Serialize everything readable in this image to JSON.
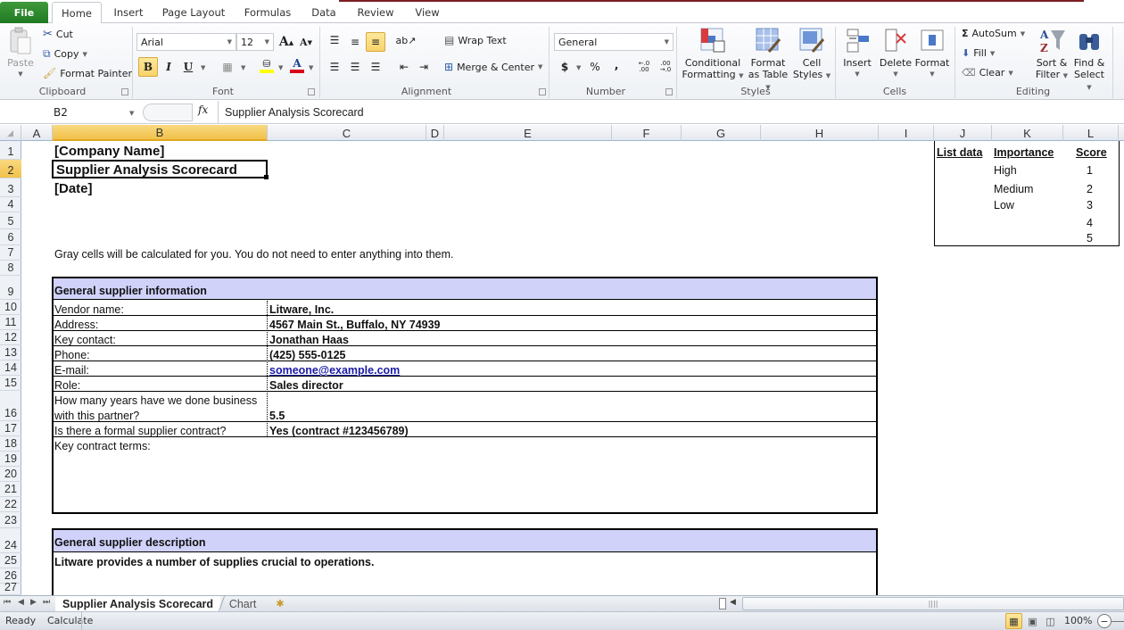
{
  "ribbon_tabs": {
    "file": "File",
    "items": [
      "Home",
      "Insert",
      "Page Layout",
      "Formulas",
      "Data",
      "Review",
      "View"
    ],
    "active": "Home"
  },
  "clipboard": {
    "paste": "Paste",
    "cut": "Cut",
    "copy": "Copy",
    "format_painter": "Format Painter",
    "label": "Clipboard"
  },
  "font": {
    "name": "Arial",
    "size": "12",
    "bold": "B",
    "italic": "I",
    "underline": "U",
    "label": "Font",
    "grow": "A",
    "shrink": "A",
    "font_color": "A"
  },
  "alignment": {
    "wrap_text": "Wrap Text",
    "merge_center": "Merge & Center",
    "label": "Alignment"
  },
  "number": {
    "format": "General",
    "currency": "$",
    "percent": "%",
    "comma": ",",
    "inc_decimal": "←.0 .00",
    "dec_decimal": ".00 →.0",
    "label": "Number"
  },
  "styles": {
    "conditional_1": "Conditional",
    "conditional_2": "Formatting",
    "format_table_1": "Format",
    "format_table_2": "as Table",
    "cell_styles_1": "Cell",
    "cell_styles_2": "Styles",
    "label": "Styles"
  },
  "cells": {
    "insert": "Insert",
    "delete": "Delete",
    "format": "Format",
    "label": "Cells"
  },
  "editing": {
    "autosum": "AutoSum",
    "fill": "Fill",
    "clear": "Clear",
    "sort_1": "Sort &",
    "sort_2": "Filter",
    "find_1": "Find &",
    "find_2": "Select",
    "label": "Editing"
  },
  "formula_bar": {
    "name_box": "B2",
    "fx": "fx",
    "content": "Supplier Analysis Scorecard"
  },
  "columns": [
    "A",
    "B",
    "C",
    "D",
    "E",
    "F",
    "G",
    "H",
    "I",
    "J",
    "K",
    "L"
  ],
  "selected_column": "B",
  "rows": [
    "1",
    "2",
    "3",
    "4",
    "5",
    "6",
    "7",
    "8",
    "9",
    "10",
    "11",
    "12",
    "13",
    "14",
    "15",
    "16",
    "17",
    "18",
    "19",
    "20",
    "21",
    "22",
    "23",
    "24",
    "25",
    "26",
    "27"
  ],
  "selected_row": "2",
  "sheet": {
    "company_name": "[Company Name]",
    "title": "Supplier Analysis Scorecard",
    "date": "[Date]",
    "note": "Gray cells will be calculated for you. You do not need to enter anything into them.",
    "section1_header": "General supplier information",
    "fields": [
      {
        "label": "Vendor name:",
        "value": "Litware, Inc."
      },
      {
        "label": "Address:",
        "value": "4567 Main St., Buffalo, NY 74939"
      },
      {
        "label": "Key contact:",
        "value": "Jonathan Haas"
      },
      {
        "label": "Phone:",
        "value": "(425) 555-0125"
      },
      {
        "label": "E-mail:",
        "value": "someone@example.com"
      },
      {
        "label": "Role:",
        "value": "Sales director"
      }
    ],
    "years_label_1": "How many years have we done business",
    "years_label_2": "with this partner?",
    "years_value": "5.5",
    "contract_label": "Is there a formal supplier contract?",
    "contract_value": "Yes (contract #123456789)",
    "key_terms_label": "Key contract terms:",
    "section2_header": "General supplier description",
    "description": "Litware provides a number of supplies crucial to operations."
  },
  "list_data": {
    "title": "List data",
    "importance_header": "Importance",
    "score_header": "Score",
    "importance": [
      "High",
      "Medium",
      "Low"
    ],
    "scores": [
      "1",
      "2",
      "3",
      "4",
      "5"
    ]
  },
  "sheet_tabs": [
    "Supplier Analysis Scorecard",
    "Chart"
  ],
  "active_sheet": "Supplier Analysis Scorecard",
  "status": {
    "ready": "Ready",
    "calculate": "Calculate",
    "zoom": "100%"
  },
  "colors": {
    "accent_file": "#2b8a2f",
    "table_header": "#d0d2fa",
    "selection": "#f1c14b",
    "link": "#1a1aa6"
  }
}
